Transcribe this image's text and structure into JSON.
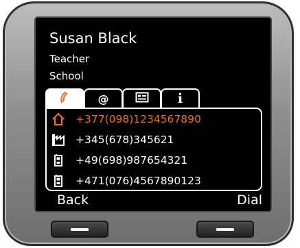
{
  "contact": {
    "name": "Susan Black",
    "title": "Teacher",
    "company": "School"
  },
  "tabs": [
    {
      "icon": "phone-icon",
      "label": "",
      "selected": true
    },
    {
      "icon": "at-icon",
      "label": "@",
      "selected": false
    },
    {
      "icon": "card-icon",
      "label": "",
      "selected": false
    },
    {
      "icon": "info-icon",
      "label": "i",
      "selected": false
    }
  ],
  "numbers": [
    {
      "type": "home-icon",
      "number": "+377(098)1234567890",
      "selected": true
    },
    {
      "type": "office-icon",
      "number": "+345(678)345621",
      "selected": false
    },
    {
      "type": "mobile-icon",
      "number": "+49(698)987654321",
      "selected": false
    },
    {
      "type": "mobile-icon",
      "number": "+471(076)4567890123",
      "selected": false
    }
  ],
  "softkeys": {
    "left": "Back",
    "right": "Dial"
  },
  "colors": {
    "accent": "#e8721f",
    "screen": "#000000",
    "text": "#ffffff"
  }
}
